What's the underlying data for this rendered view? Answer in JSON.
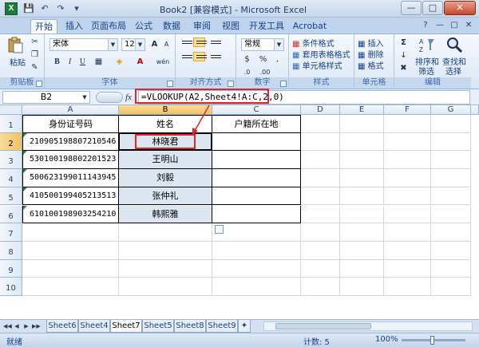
{
  "window": {
    "title": "Book2  [兼容模式] - Microsoft Excel",
    "app_icon": "X"
  },
  "tabs": [
    "开始",
    "插入",
    "页面布局",
    "公式",
    "数据",
    "审阅",
    "视图",
    "开发工具",
    "Acrobat"
  ],
  "ribbon": {
    "clipboard": {
      "paste": "粘贴",
      "label": "剪贴板"
    },
    "font": {
      "name": "宋体",
      "size": "12",
      "label": "字体",
      "bold": "B",
      "italic": "I",
      "underline": "U",
      "grow": "A",
      "shrink": "A",
      "font_color": "A",
      "wen": "wén"
    },
    "alignment": {
      "label": "对齐方式"
    },
    "number": {
      "format": "常规",
      "percent": "%",
      "comma": ",",
      "label": "数字",
      "currency": "$",
      "inc": ".0",
      "dec": ".00"
    },
    "styles": {
      "conditional": "条件格式",
      "table": "套用表格格式",
      "cell": "单元格样式",
      "label": "样式"
    },
    "cells": {
      "insert": "插入",
      "delete": "删除",
      "format": "格式",
      "label": "单元格"
    },
    "editing": {
      "sort": "排序和筛选",
      "sort_l1": "排序和",
      "sort_l2": "筛选",
      "find": "查找和选择",
      "find_l1": "查找和",
      "find_l2": "选择",
      "label": "编辑",
      "sigma": "Σ"
    }
  },
  "formula_bar": {
    "name_box": "B2",
    "fx": "fx",
    "formula": "=VLOOKUP(A2,Sheet4!A:C,2,0)"
  },
  "columns": [
    "A",
    "B",
    "C",
    "D",
    "E",
    "F",
    "G"
  ],
  "rows": [
    "1",
    "2",
    "3",
    "4",
    "5",
    "6",
    "7",
    "8",
    "9",
    "10"
  ],
  "table": {
    "headers": [
      "身份证号码",
      "姓名",
      "户籍所在地"
    ],
    "data": [
      {
        "id": "210905198807210546",
        "name": "林晓君"
      },
      {
        "id": "530100198002201523",
        "name": "王明山"
      },
      {
        "id": "500623199011143945",
        "name": "刘毅"
      },
      {
        "id": "410500199405213513",
        "name": "张仲礼"
      },
      {
        "id": "610100198903254210",
        "name": "韩熙雅"
      }
    ]
  },
  "sheets": [
    "Sheet6",
    "Sheet4",
    "Sheet7",
    "Sheet5",
    "Sheet8",
    "Sheet9"
  ],
  "active_sheet": "Sheet7",
  "status": {
    "ready": "就绪",
    "count": "计数: 5",
    "zoom": "100%"
  },
  "colors": {
    "highlight_red": "#e0262d",
    "ribbon_blue": "#15428b",
    "selected_fill": "#dce6f1"
  }
}
